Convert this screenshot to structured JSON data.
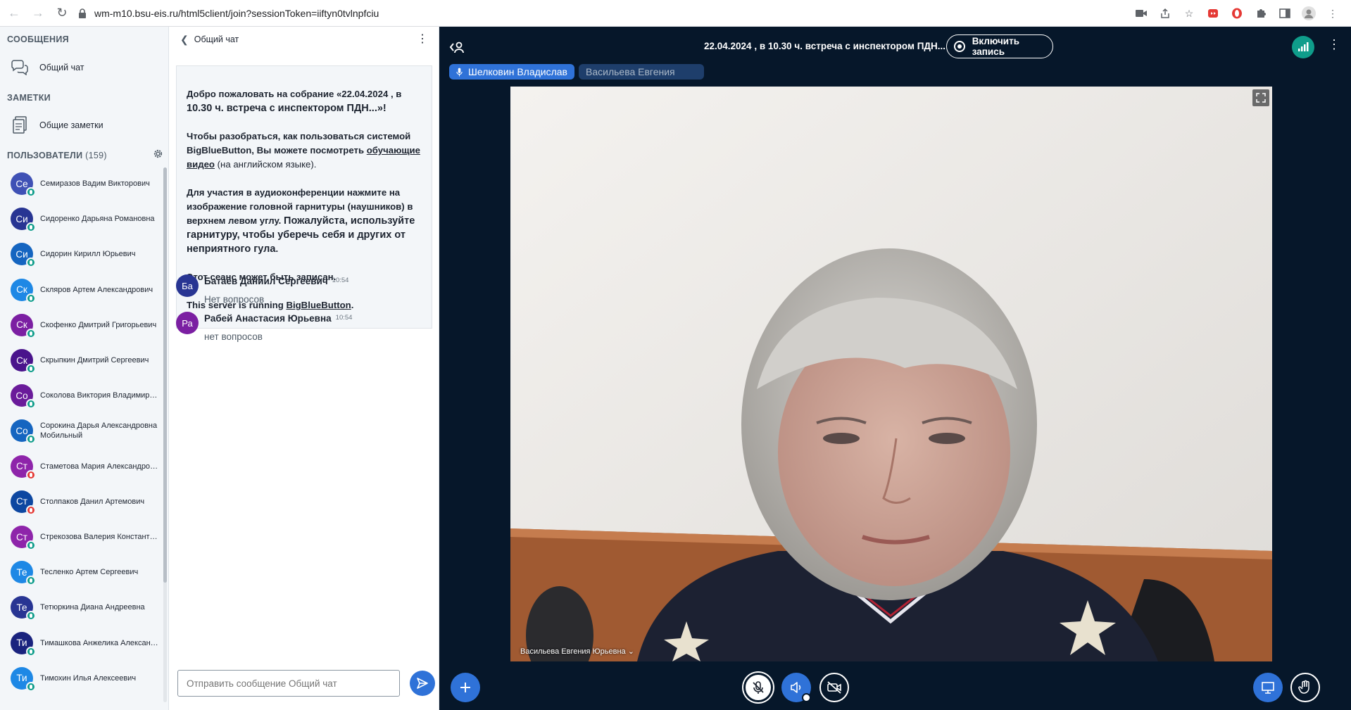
{
  "browser": {
    "url": "wm-m10.bsu-eis.ru/html5client/join?sessionToken=iiftyn0tvlnpfciu"
  },
  "sidebar": {
    "messages_title": "СООБЩЕНИЯ",
    "public_chat": "Общий чат",
    "notes_title": "ЗАМЕТКИ",
    "shared_notes": "Общие заметки",
    "users_title": "ПОЛЬЗОВАТЕЛИ",
    "users_count": "(159)",
    "users": [
      {
        "initials": "Се",
        "name": "Семиразов Вадим Викторович",
        "name2": "",
        "color": "#3f51b5",
        "muted": false
      },
      {
        "initials": "Си",
        "name": "Сидоренко Дарьяна Романовна",
        "name2": "",
        "color": "#283593",
        "muted": false
      },
      {
        "initials": "Си",
        "name": "Сидорин Кирилл Юрьевич",
        "name2": "",
        "color": "#1565c0",
        "muted": false
      },
      {
        "initials": "Ск",
        "name": "Скляров Артем Александрович",
        "name2": "",
        "color": "#1e88e5",
        "muted": false
      },
      {
        "initials": "Ск",
        "name": "Скофенко Дмитрий Григорьевич",
        "name2": "",
        "color": "#7b1fa2",
        "muted": false
      },
      {
        "initials": "Ск",
        "name": "Скрыпкин Дмитрий Сергеевич",
        "name2": "",
        "color": "#4a148c",
        "muted": false
      },
      {
        "initials": "Со",
        "name": "Соколова Виктория Владимировна",
        "name2": "",
        "color": "#6a1b9a",
        "muted": false
      },
      {
        "initials": "Со",
        "name": "Сорокина Дарья Александровна",
        "name2": "Мобильный",
        "color": "#1565c0",
        "muted": false
      },
      {
        "initials": "Ст",
        "name": "Стаметова Мария Александровна",
        "name2": "",
        "color": "#8e24aa",
        "muted": true
      },
      {
        "initials": "Ст",
        "name": "Столпаков Данил Артемович",
        "name2": "",
        "color": "#0d47a1",
        "muted": true
      },
      {
        "initials": "Ст",
        "name": "Стрекозова Валерия Константиновна",
        "name2": "",
        "color": "#8e24aa",
        "muted": false
      },
      {
        "initials": "Те",
        "name": "Тесленко Артем Сергеевич",
        "name2": "",
        "color": "#1e88e5",
        "muted": false
      },
      {
        "initials": "Те",
        "name": "Тетюркина Диана Андреевна",
        "name2": "",
        "color": "#283593",
        "muted": false
      },
      {
        "initials": "Ти",
        "name": "Тимашкова Анжелика Александровна",
        "name2": "",
        "color": "#1a237e",
        "muted": false
      },
      {
        "initials": "Ти",
        "name": "Тимохин Илья Алексеевич",
        "name2": "",
        "color": "#1e88e5",
        "muted": false
      }
    ]
  },
  "chat": {
    "header": "Общий чат",
    "welcome_line1": "Добро пожаловать на собрание «22.04.2024 , в",
    "welcome_line2": "10.30 ч. встреча с инспектором ПДН...»!",
    "help_pre": "Чтобы разобраться, как пользоваться системой BigBlueButton, Вы можете посмотреть ",
    "help_link": "обучающие видео",
    "help_post": " (на английском языке).",
    "audio_pre": "Для участия в аудиоконференции нажмите на изображение головной гарнитуры (наушников) в верхнем левом углу. ",
    "audio_bold": "Пожалуйста, используйте гарнитуру, чтобы уберечь себя и других от неприятного гула",
    "audio_post": ".",
    "recorded": "Этот сеанс может быть записан.",
    "server_pre": "This server is running ",
    "server_link": "BigBlueButton",
    "server_post": ".",
    "messages": [
      {
        "initials": "Ба",
        "author": "Батаев Даниил Сергеевич",
        "time": "10:54",
        "text": "Нет вопросов",
        "color": "#283593"
      },
      {
        "initials": "Ра",
        "author": "Рабей Анастасия Юрьевна",
        "time": "10:54",
        "text": "нет вопросов",
        "color": "#7b1fa2"
      }
    ],
    "input_placeholder": "Отправить сообщение Общий чат"
  },
  "main": {
    "meeting_title": "22.04.2024 , в 10.30 ч. встреча с инспектором ПДН...",
    "record_label": "Включить запись",
    "talkers": [
      "Шелковин Владислав",
      "Васильева Евгения"
    ],
    "video_name": "Васильева Евгения Юрьевна"
  },
  "colors": {
    "primary": "#2f72d8",
    "dark_bg": "#06172a",
    "connection": "#0f9d8b",
    "unmuted_badge": "#0f9d8b",
    "muted_badge": "#e53935"
  }
}
